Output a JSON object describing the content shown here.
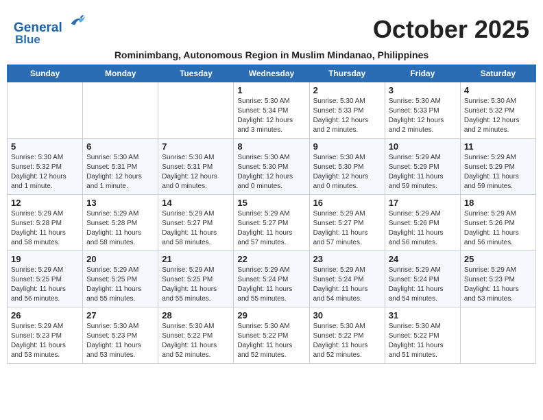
{
  "header": {
    "logo_line1": "General",
    "logo_line2": "Blue",
    "month_title": "October 2025",
    "subtitle": "Rominimbang, Autonomous Region in Muslim Mindanao, Philippines"
  },
  "days_of_week": [
    "Sunday",
    "Monday",
    "Tuesday",
    "Wednesday",
    "Thursday",
    "Friday",
    "Saturday"
  ],
  "weeks": [
    [
      {
        "day": "",
        "info": ""
      },
      {
        "day": "",
        "info": ""
      },
      {
        "day": "",
        "info": ""
      },
      {
        "day": "1",
        "info": "Sunrise: 5:30 AM\nSunset: 5:34 PM\nDaylight: 12 hours and 3 minutes."
      },
      {
        "day": "2",
        "info": "Sunrise: 5:30 AM\nSunset: 5:33 PM\nDaylight: 12 hours and 2 minutes."
      },
      {
        "day": "3",
        "info": "Sunrise: 5:30 AM\nSunset: 5:33 PM\nDaylight: 12 hours and 2 minutes."
      },
      {
        "day": "4",
        "info": "Sunrise: 5:30 AM\nSunset: 5:32 PM\nDaylight: 12 hours and 2 minutes."
      }
    ],
    [
      {
        "day": "5",
        "info": "Sunrise: 5:30 AM\nSunset: 5:32 PM\nDaylight: 12 hours and 1 minute."
      },
      {
        "day": "6",
        "info": "Sunrise: 5:30 AM\nSunset: 5:31 PM\nDaylight: 12 hours and 1 minute."
      },
      {
        "day": "7",
        "info": "Sunrise: 5:30 AM\nSunset: 5:31 PM\nDaylight: 12 hours and 0 minutes."
      },
      {
        "day": "8",
        "info": "Sunrise: 5:30 AM\nSunset: 5:30 PM\nDaylight: 12 hours and 0 minutes."
      },
      {
        "day": "9",
        "info": "Sunrise: 5:30 AM\nSunset: 5:30 PM\nDaylight: 12 hours and 0 minutes."
      },
      {
        "day": "10",
        "info": "Sunrise: 5:29 AM\nSunset: 5:29 PM\nDaylight: 11 hours and 59 minutes."
      },
      {
        "day": "11",
        "info": "Sunrise: 5:29 AM\nSunset: 5:29 PM\nDaylight: 11 hours and 59 minutes."
      }
    ],
    [
      {
        "day": "12",
        "info": "Sunrise: 5:29 AM\nSunset: 5:28 PM\nDaylight: 11 hours and 58 minutes."
      },
      {
        "day": "13",
        "info": "Sunrise: 5:29 AM\nSunset: 5:28 PM\nDaylight: 11 hours and 58 minutes."
      },
      {
        "day": "14",
        "info": "Sunrise: 5:29 AM\nSunset: 5:27 PM\nDaylight: 11 hours and 58 minutes."
      },
      {
        "day": "15",
        "info": "Sunrise: 5:29 AM\nSunset: 5:27 PM\nDaylight: 11 hours and 57 minutes."
      },
      {
        "day": "16",
        "info": "Sunrise: 5:29 AM\nSunset: 5:27 PM\nDaylight: 11 hours and 57 minutes."
      },
      {
        "day": "17",
        "info": "Sunrise: 5:29 AM\nSunset: 5:26 PM\nDaylight: 11 hours and 56 minutes."
      },
      {
        "day": "18",
        "info": "Sunrise: 5:29 AM\nSunset: 5:26 PM\nDaylight: 11 hours and 56 minutes."
      }
    ],
    [
      {
        "day": "19",
        "info": "Sunrise: 5:29 AM\nSunset: 5:25 PM\nDaylight: 11 hours and 56 minutes."
      },
      {
        "day": "20",
        "info": "Sunrise: 5:29 AM\nSunset: 5:25 PM\nDaylight: 11 hours and 55 minutes."
      },
      {
        "day": "21",
        "info": "Sunrise: 5:29 AM\nSunset: 5:25 PM\nDaylight: 11 hours and 55 minutes."
      },
      {
        "day": "22",
        "info": "Sunrise: 5:29 AM\nSunset: 5:24 PM\nDaylight: 11 hours and 55 minutes."
      },
      {
        "day": "23",
        "info": "Sunrise: 5:29 AM\nSunset: 5:24 PM\nDaylight: 11 hours and 54 minutes."
      },
      {
        "day": "24",
        "info": "Sunrise: 5:29 AM\nSunset: 5:24 PM\nDaylight: 11 hours and 54 minutes."
      },
      {
        "day": "25",
        "info": "Sunrise: 5:29 AM\nSunset: 5:23 PM\nDaylight: 11 hours and 53 minutes."
      }
    ],
    [
      {
        "day": "26",
        "info": "Sunrise: 5:29 AM\nSunset: 5:23 PM\nDaylight: 11 hours and 53 minutes."
      },
      {
        "day": "27",
        "info": "Sunrise: 5:30 AM\nSunset: 5:23 PM\nDaylight: 11 hours and 53 minutes."
      },
      {
        "day": "28",
        "info": "Sunrise: 5:30 AM\nSunset: 5:22 PM\nDaylight: 11 hours and 52 minutes."
      },
      {
        "day": "29",
        "info": "Sunrise: 5:30 AM\nSunset: 5:22 PM\nDaylight: 11 hours and 52 minutes."
      },
      {
        "day": "30",
        "info": "Sunrise: 5:30 AM\nSunset: 5:22 PM\nDaylight: 11 hours and 52 minutes."
      },
      {
        "day": "31",
        "info": "Sunrise: 5:30 AM\nSunset: 5:22 PM\nDaylight: 11 hours and 51 minutes."
      },
      {
        "day": "",
        "info": ""
      }
    ]
  ]
}
